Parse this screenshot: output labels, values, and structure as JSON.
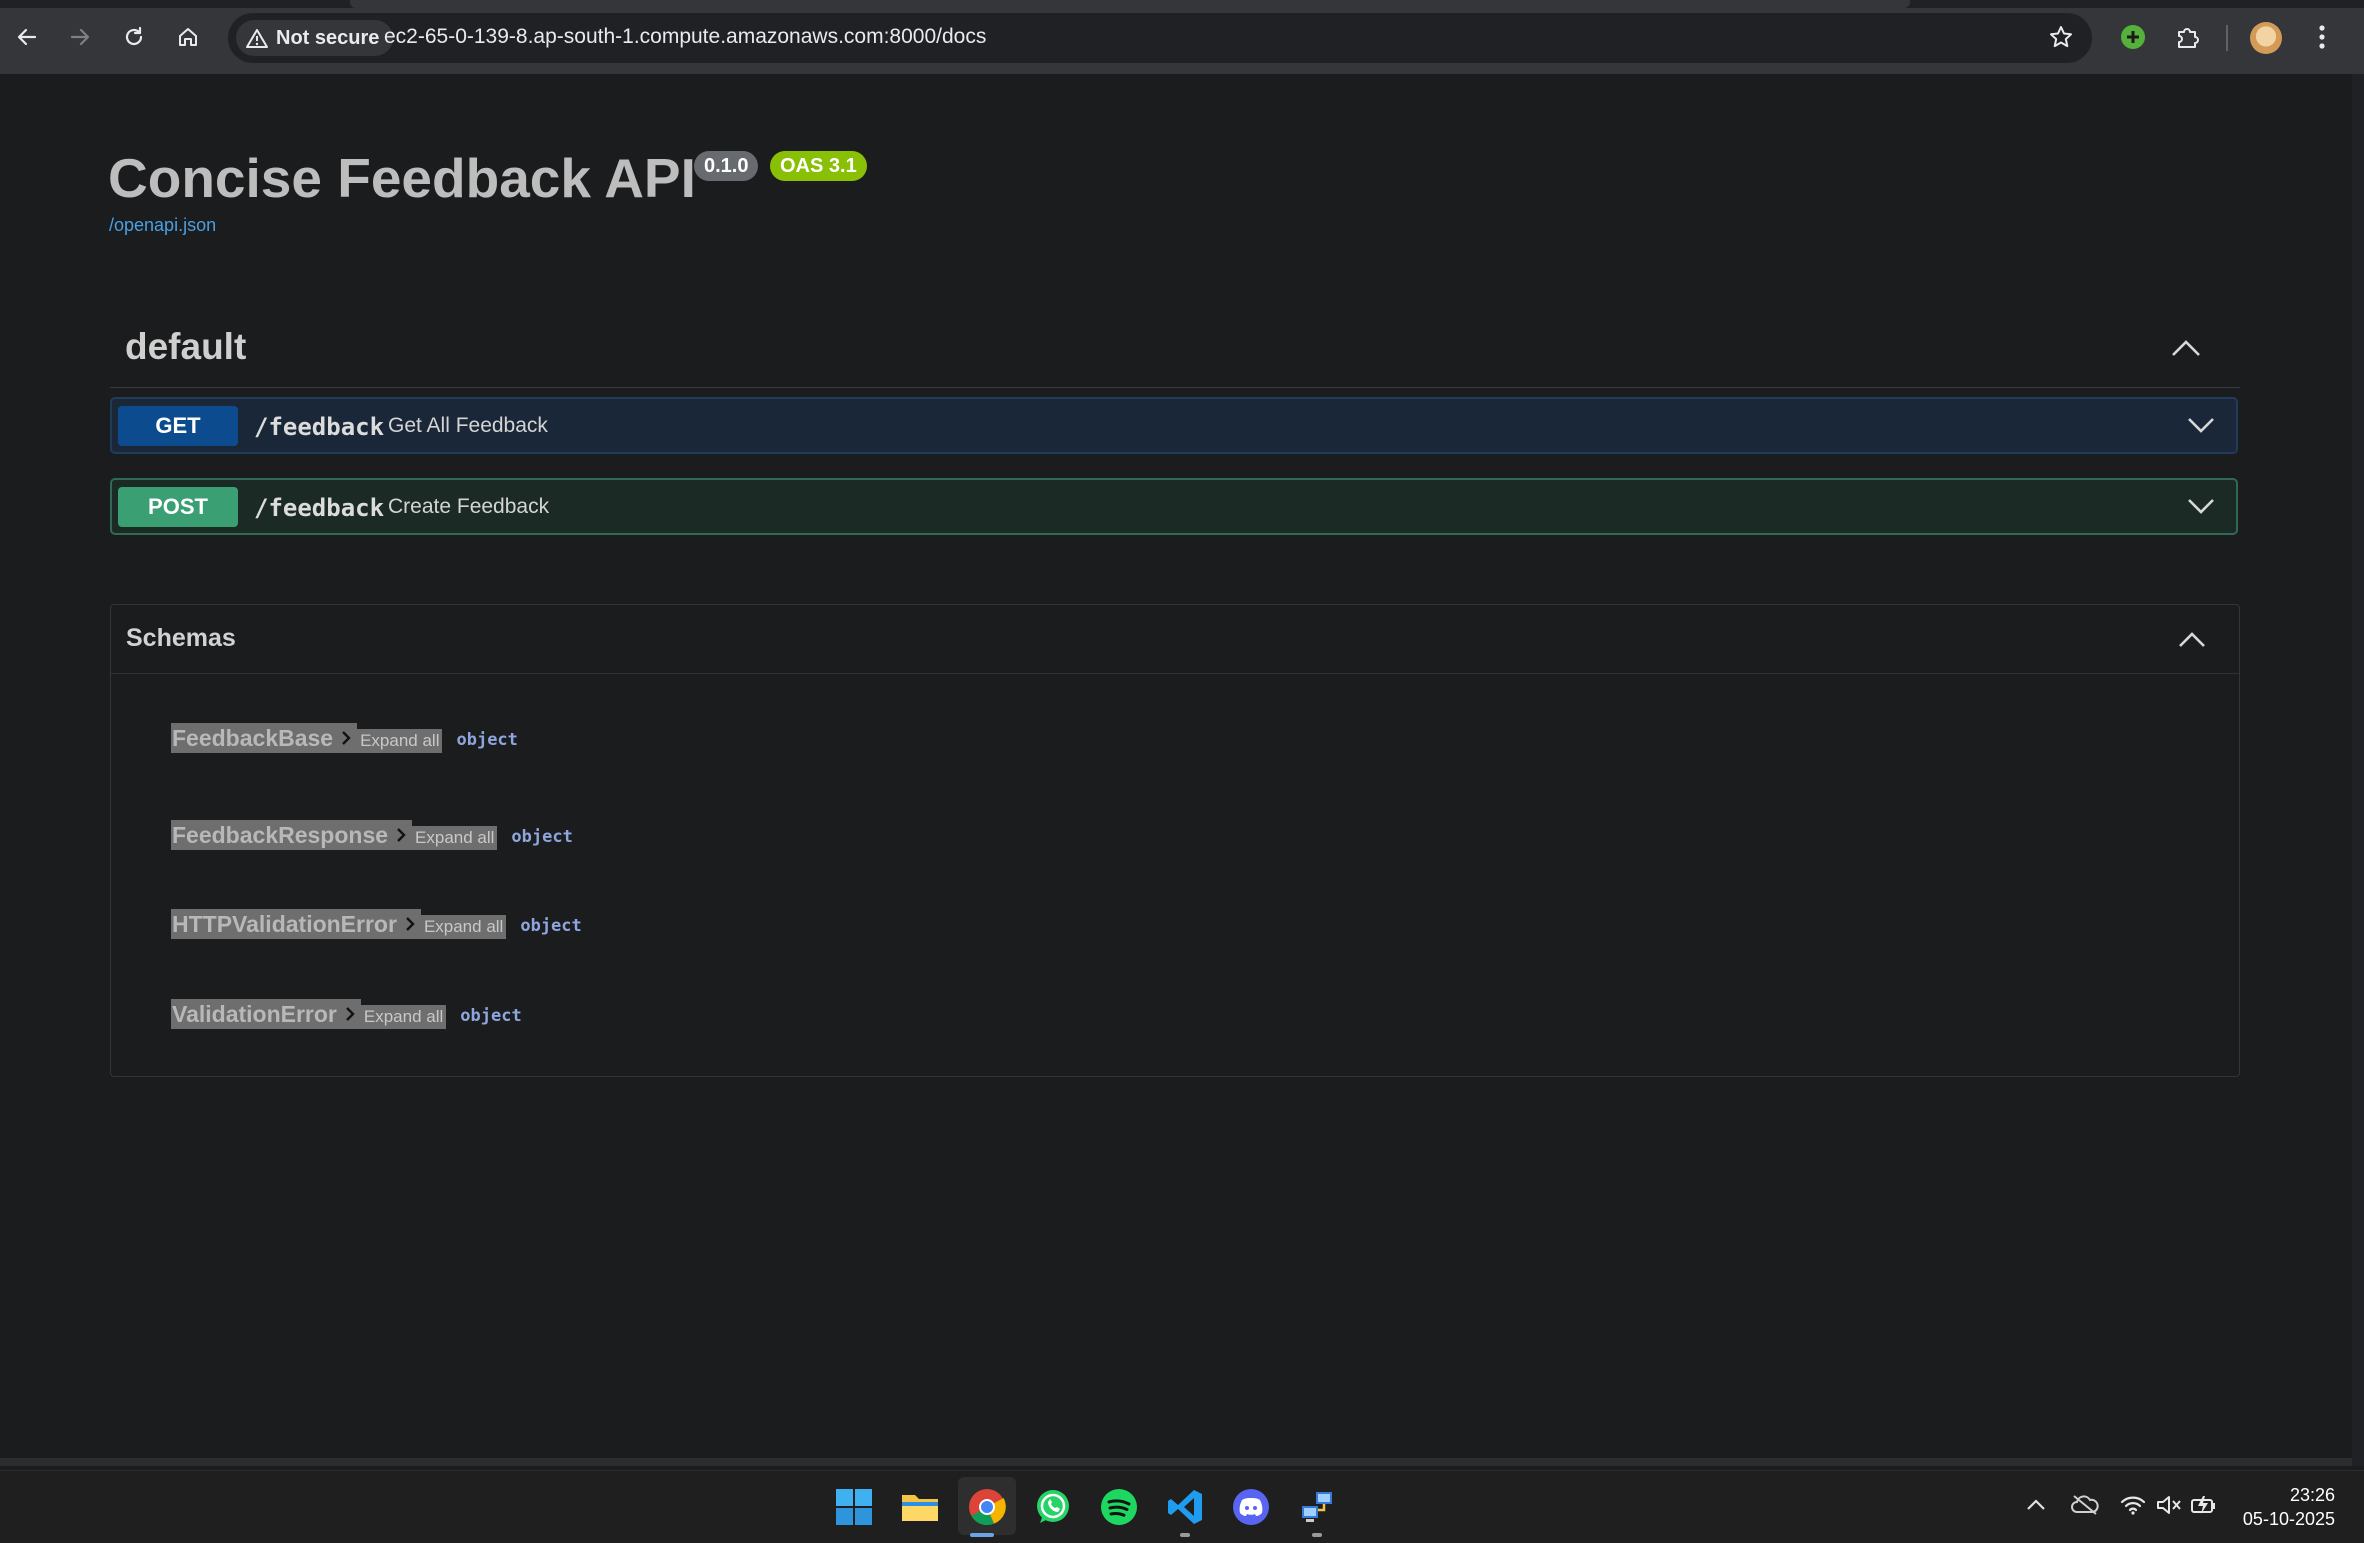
{
  "browser": {
    "security_label": "Not secure",
    "url": "ec2-65-0-139-8.ap-south-1.compute.amazonaws.com:8000/docs"
  },
  "api": {
    "title": "Concise Feedback API",
    "version_badge": "0.1.0",
    "oas_badge": "OAS 3.1",
    "spec_link": "/openapi.json"
  },
  "section": {
    "name": "default",
    "operations": [
      {
        "method": "GET",
        "path": "/feedback",
        "summary": "Get All Feedback",
        "color": "#0d4b8f"
      },
      {
        "method": "POST",
        "path": "/feedback",
        "summary": "Create Feedback",
        "color": "#3a9f73"
      }
    ]
  },
  "schemas": {
    "title": "Schemas",
    "expand_label": "Expand all",
    "items": [
      {
        "name": "FeedbackBase",
        "type": "object"
      },
      {
        "name": "FeedbackResponse",
        "type": "object"
      },
      {
        "name": "HTTPValidationError",
        "type": "object"
      },
      {
        "name": "ValidationError",
        "type": "object"
      }
    ]
  },
  "taskbar": {
    "apps": [
      "windows-start-icon",
      "file-explorer-icon",
      "chrome-icon",
      "whatsapp-icon",
      "spotify-icon",
      "vscode-icon",
      "discord-icon",
      "network-tool-icon"
    ],
    "time": "23:26",
    "date": "05-10-2025"
  }
}
